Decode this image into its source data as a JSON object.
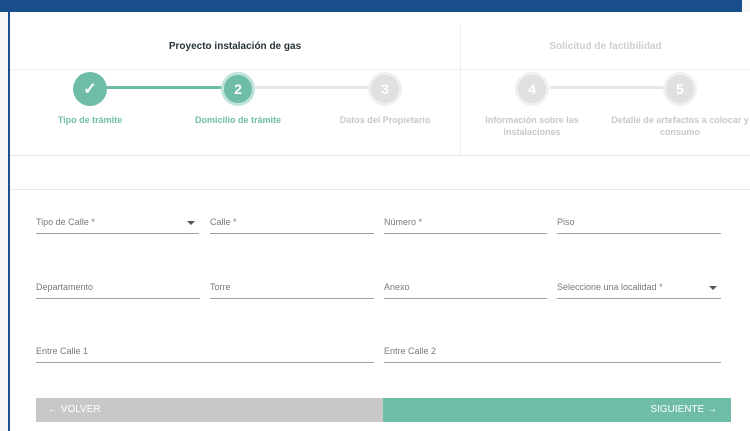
{
  "header": {
    "group_a": "Proyecto instalación de gas",
    "group_b": "Solicitud de factibilidad"
  },
  "steps": [
    {
      "number": "✓",
      "label": "Tipo de trámite",
      "state": "done"
    },
    {
      "number": "2",
      "label": "Domicilio de trámite",
      "state": "current"
    },
    {
      "number": "3",
      "label": "Datos del Propietario",
      "state": "pending"
    },
    {
      "number": "4",
      "label": "Información sobre las instalaciones",
      "state": "pending"
    },
    {
      "number": "5",
      "label": "Detalle de artefactos a colocar y consumo",
      "state": "pending"
    }
  ],
  "colors": {
    "accent": "#6fbda9",
    "pending": "#e0e0e0",
    "brand": "#1a4d8c"
  },
  "form": {
    "tipo_calle": "Tipo de Calle *",
    "calle": "Calle *",
    "numero": "Número *",
    "piso": "Piso",
    "departamento": "Departamento",
    "torre": "Torre",
    "anexo": "Anexo",
    "localidad": "Seleccione una localidad *",
    "entre_calle_1": "Entre Calle 1",
    "entre_calle_2": "Entre Calle 2"
  },
  "buttons": {
    "back": "← VOLVER",
    "next": "SIGUIENTE →"
  }
}
